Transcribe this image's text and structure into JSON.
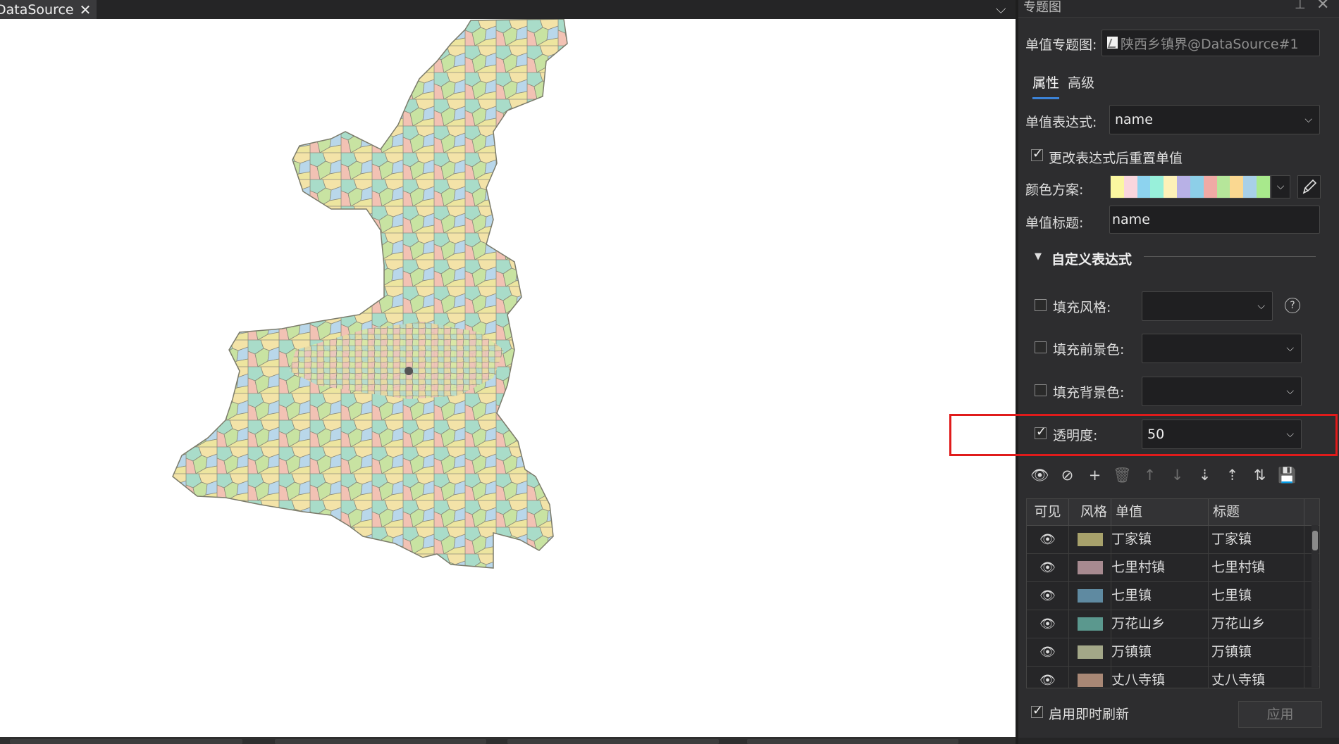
{
  "document_tab": {
    "title": "DataSource",
    "close_glyph": "✕"
  },
  "tab_dropdown_glyph": "⌵",
  "panel": {
    "title": "专题图",
    "pin_glyph": "⊥",
    "close_glyph": "✕",
    "layer_label": "单值专题图:",
    "layer_value": "陕西乡镇界@DataSource#1",
    "tabs": [
      {
        "label": "属性",
        "active": true
      },
      {
        "label": "高级",
        "active": false
      }
    ],
    "expression_label": "单值表达式:",
    "expression_value": "name",
    "reset_checkbox": {
      "label": "更改表达式后重置单值",
      "checked": true
    },
    "color_scheme_label": "颜色方案:",
    "color_scheme": [
      "#fbf7a0",
      "#f9d6dd",
      "#8dd3ef",
      "#98f0da",
      "#fdf1b8",
      "#b8b1e6",
      "#8dcfe8",
      "#f0aaa5",
      "#b6e69a",
      "#fad891",
      "#a8d0e8",
      "#a8e98c"
    ],
    "title_label": "单值标题:",
    "title_value": "name",
    "custom_section": "自定义表达式",
    "fill_style": {
      "label": "填充风格:",
      "checked": false,
      "value": ""
    },
    "fill_fore": {
      "label": "填充前景色:",
      "checked": false,
      "value": ""
    },
    "fill_back": {
      "label": "填充背景色:",
      "checked": false,
      "value": ""
    },
    "transparency": {
      "label": "透明度:",
      "checked": true,
      "value": "50"
    },
    "help_glyph": "?",
    "toolbar": [
      {
        "name": "visibility-icon",
        "glyph": "👁",
        "enabled": true
      },
      {
        "name": "style-icon",
        "glyph": "⊘",
        "enabled": true
      },
      {
        "name": "add-icon",
        "glyph": "+",
        "enabled": true
      },
      {
        "name": "delete-icon",
        "glyph": "🗑",
        "enabled": false
      },
      {
        "name": "move-up-icon",
        "glyph": "↑",
        "enabled": false
      },
      {
        "name": "move-down-icon",
        "glyph": "↓",
        "enabled": false
      },
      {
        "name": "sort-asc-icon",
        "glyph": "⇣",
        "enabled": true
      },
      {
        "name": "sort-desc-icon",
        "glyph": "⇡",
        "enabled": true
      },
      {
        "name": "reverse-icon",
        "glyph": "⇅",
        "enabled": true
      },
      {
        "name": "save-icon",
        "glyph": "💾",
        "enabled": true
      }
    ],
    "table": {
      "headers": [
        "可见",
        "风格",
        "单值",
        "标题"
      ],
      "rows": [
        {
          "color": "#a7a16b",
          "value": "丁家镇",
          "title": "丁家镇"
        },
        {
          "color": "#a78a90",
          "value": "七里村镇",
          "title": "七里村镇"
        },
        {
          "color": "#5f8aa1",
          "value": "七里镇",
          "title": "七里镇"
        },
        {
          "color": "#5b988e",
          "value": "万花山乡",
          "title": "万花山乡"
        },
        {
          "color": "#a3a788",
          "value": "万镇镇",
          "title": "万镇镇"
        },
        {
          "color": "#a88775",
          "value": "丈八寺镇",
          "title": "丈八寺镇"
        }
      ]
    },
    "instant_refresh": {
      "label": "启用即时刷新",
      "checked": true
    },
    "apply_label": "应用"
  }
}
